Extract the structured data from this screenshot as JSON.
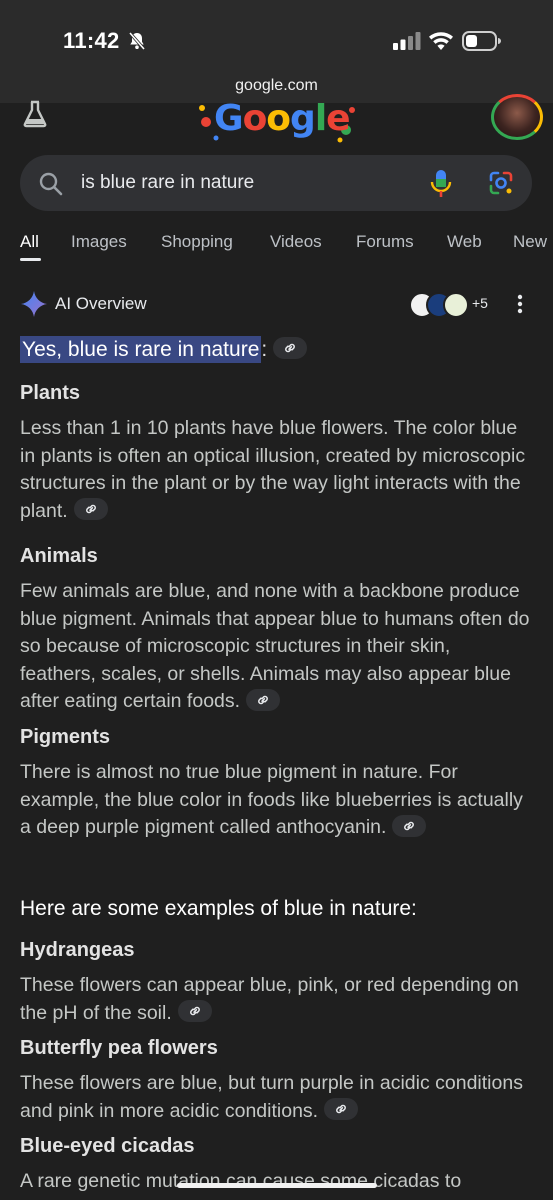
{
  "status": {
    "time": "11:42",
    "url": "google.com"
  },
  "search": {
    "query": "is blue rare in nature"
  },
  "tabs": [
    {
      "label": "All"
    },
    {
      "label": "Images"
    },
    {
      "label": "Shopping"
    },
    {
      "label": "Videos"
    },
    {
      "label": "Forums"
    },
    {
      "label": "Web"
    },
    {
      "label": "New"
    }
  ],
  "ai_overview": {
    "title": "AI Overview",
    "sources_more": "+5",
    "lead_highlight": "Yes, blue is rare in nature",
    "lead_colon": ":",
    "sections": [
      {
        "heading": "Plants",
        "text": "Less than 1 in 10 plants have blue flowers. The color blue in plants is often an optical illusion, created by microscopic structures in the plant or by the way light interacts with the plant."
      },
      {
        "heading": "Animals",
        "text": "Few animals are blue, and none with a backbone produce blue pigment. Animals that appear blue to humans often do so because of microscopic structures in their skin, feathers, scales, or shells. Animals may also appear blue after eating certain foods."
      },
      {
        "heading": "Pigments",
        "text": "There is almost no true blue pigment in nature. For example, the blue color in foods like blueberries is actually a deep purple pigment called anthocyanin."
      }
    ],
    "examples_heading": "Here are some examples of blue in nature:",
    "examples": [
      {
        "heading": "Hydrangeas",
        "text": "These flowers can appear blue, pink, or red depending on the pH of the soil."
      },
      {
        "heading": "Butterfly pea flowers",
        "text": "These flowers are blue, but turn purple in acidic conditions and pink in more acidic conditions."
      },
      {
        "heading": "Blue-eyed cicadas",
        "text": "A rare genetic mutation can cause some cicadas to"
      }
    ]
  },
  "colors": {
    "background": "#1f1f1f",
    "highlight": "#394883",
    "searchbox": "#303134",
    "accent_blue": "#8ab4f8"
  },
  "icons": [
    "bell-slash-icon",
    "signal-icon",
    "wifi-icon",
    "battery-icon",
    "flask-icon",
    "search-icon",
    "mic-icon",
    "lens-icon",
    "sparkle-icon",
    "kebab-icon",
    "link-icon"
  ]
}
